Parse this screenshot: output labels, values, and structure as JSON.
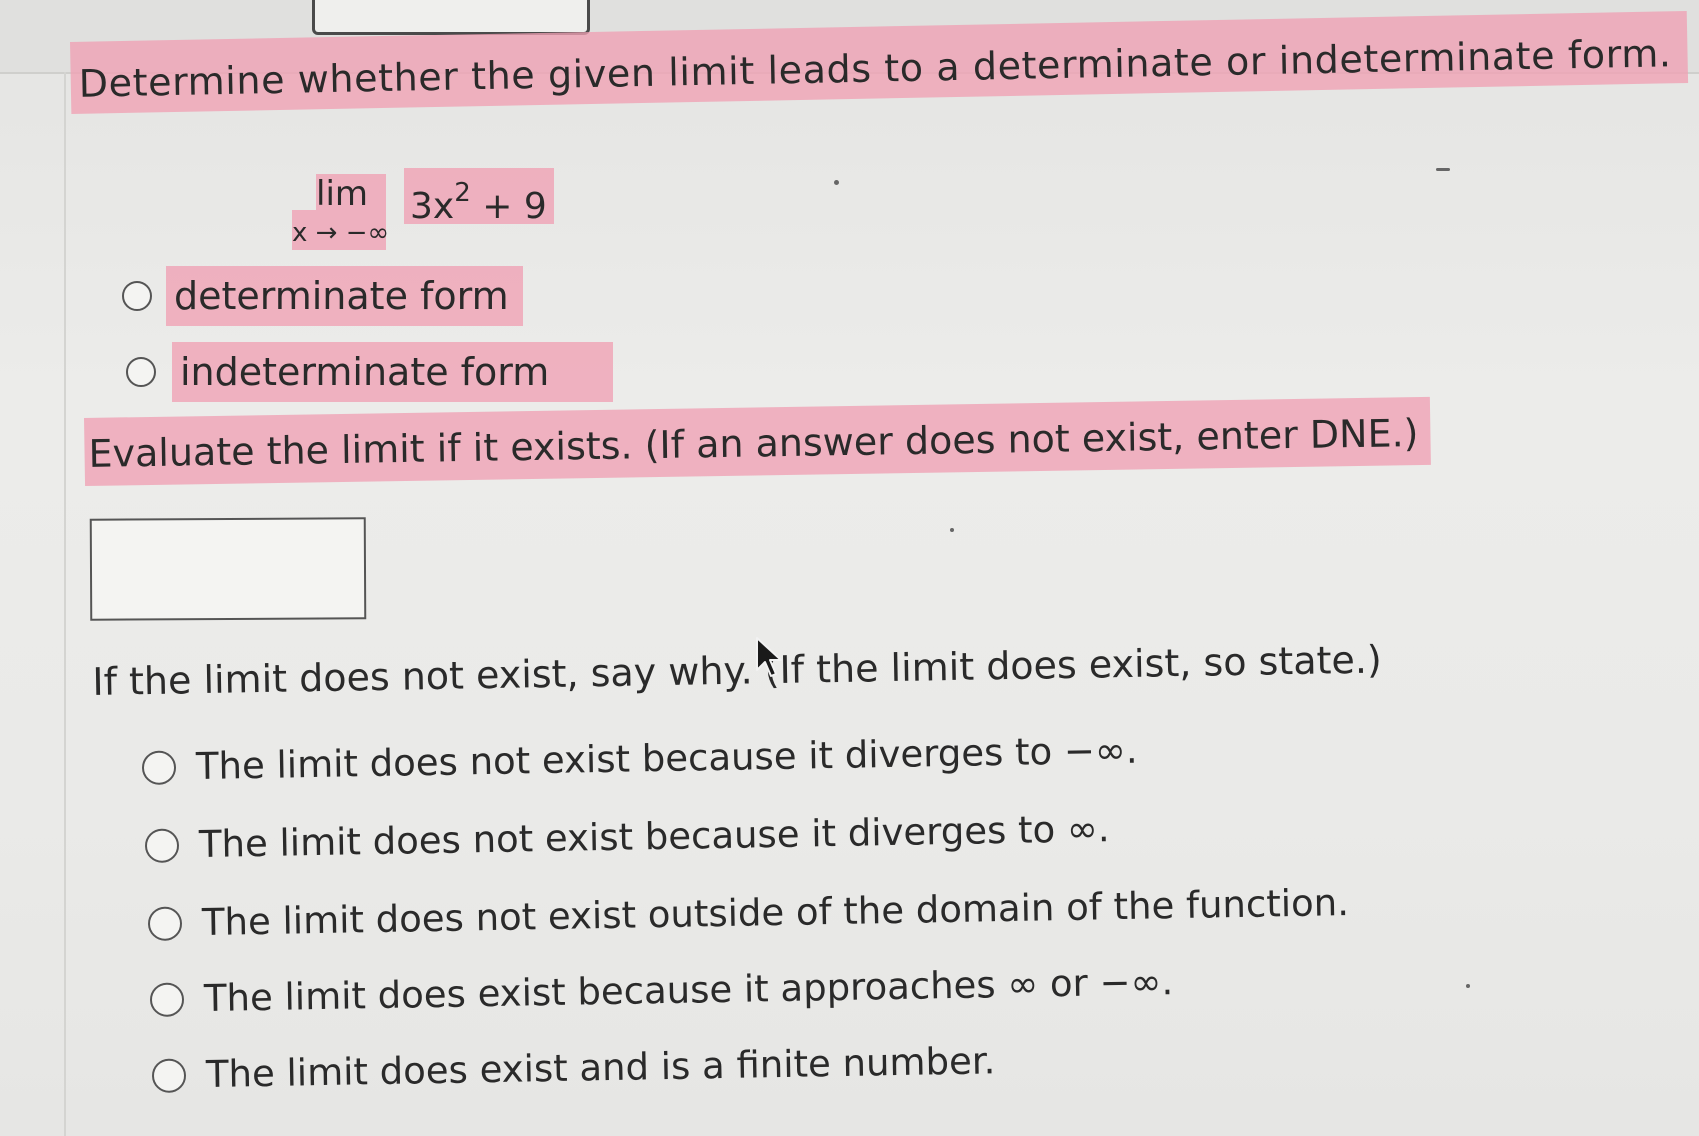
{
  "question": {
    "prompt": "Determine whether the given limit leads to a determinate or indeterminate form."
  },
  "limit": {
    "operator": "lim",
    "subscript": "x → −∞",
    "function_base": "3x",
    "function_exponent": "2",
    "function_tail": " + 9"
  },
  "form_options": [
    {
      "label": "determinate form",
      "selected": false
    },
    {
      "label": "indeterminate form",
      "selected": false
    }
  ],
  "evaluate": {
    "prompt": "Evaluate the limit if it exists. (If an answer does not exist, enter DNE.)",
    "answer_value": ""
  },
  "reason": {
    "prompt": "If the limit does not exist, say why. (If the limit does exist, so state.)",
    "options": [
      {
        "label": "The limit does not exist because it diverges to −∞.",
        "selected": false
      },
      {
        "label": "The limit does not exist because it diverges to ∞.",
        "selected": false
      },
      {
        "label": "The limit does not exist outside of the domain of the function.",
        "selected": false
      },
      {
        "label": "The limit does exist because it approaches ∞ or −∞.",
        "selected": false
      },
      {
        "label": "The limit does exist and is a finite number.",
        "selected": false
      }
    ]
  },
  "colors": {
    "highlight": "#f0a0b4",
    "text": "#2a2a2a",
    "background": "#ebebe9"
  }
}
